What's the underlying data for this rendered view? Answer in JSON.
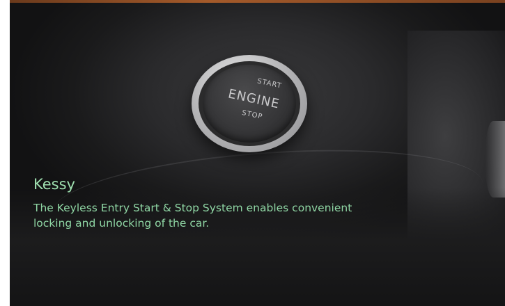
{
  "photo": {
    "button_label_start": "START",
    "button_label_engine": "ENGINE",
    "button_label_stop": "STOP"
  },
  "caption": {
    "title": "Kessy",
    "body": "The Keyless Entry Start & Stop System enables convenient locking and unlocking of the car."
  },
  "colors": {
    "caption_text": "#9fe0b0",
    "accent_strip": "#a45a2a",
    "background": "#0f0f10"
  }
}
